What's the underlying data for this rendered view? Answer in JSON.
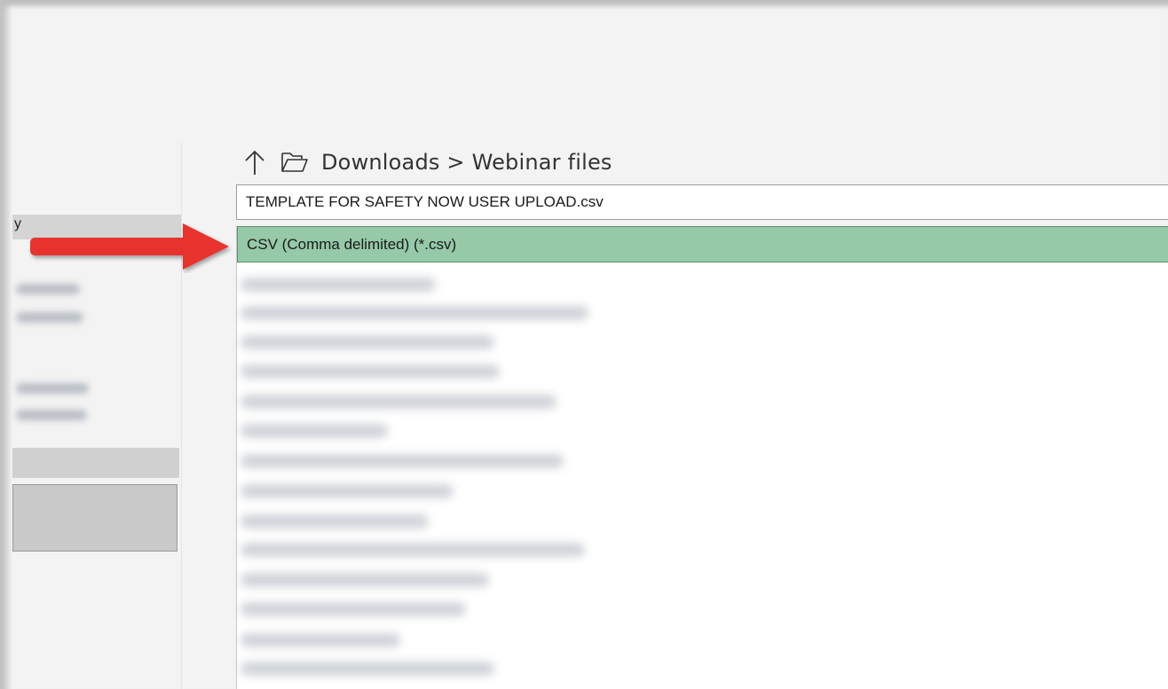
{
  "navigation": {
    "up_icon": "arrow-up-icon",
    "folder_icon": "folder-open-icon",
    "breadcrumb": "Downloads > Webinar files"
  },
  "filename": {
    "value": "TEMPLATE FOR SAFETY NOW USER UPLOAD.csv"
  },
  "file_types": {
    "selected": "CSV (Comma delimited) (*.csv)"
  },
  "left_pane": {
    "visible_fragment": "y"
  },
  "annotation": {
    "arrow_color": "#e8302d",
    "icon": "red-arrow-pointer"
  },
  "colors": {
    "selection_fill": "#95c9a8",
    "selection_border": "#5e8e6f"
  }
}
